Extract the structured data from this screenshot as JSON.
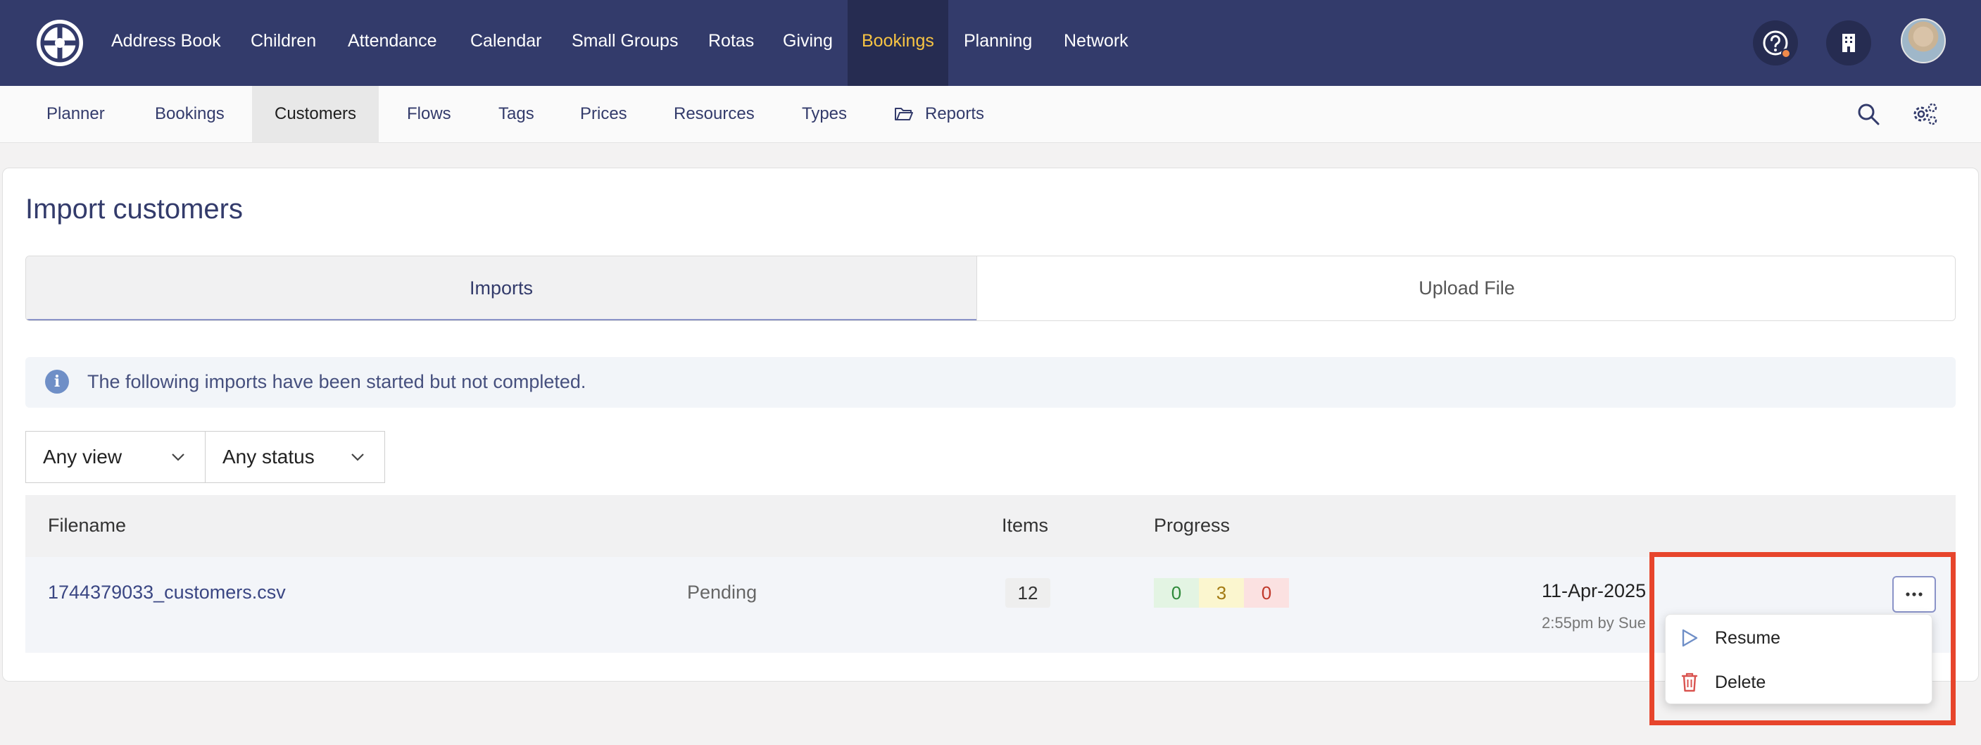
{
  "topnav": {
    "items": [
      "Address Book",
      "Children",
      "Attendance",
      "Calendar",
      "Small Groups",
      "Rotas",
      "Giving",
      "Bookings",
      "Planning",
      "Network"
    ],
    "active": "Bookings",
    "icons": [
      "help-icon",
      "building-icon",
      "avatar"
    ]
  },
  "subnav": {
    "items": [
      "Planner",
      "Bookings",
      "Customers",
      "Flows",
      "Tags",
      "Prices",
      "Resources",
      "Types",
      "Reports"
    ],
    "active": "Customers",
    "icons": [
      "folder-icon",
      "search-icon",
      "settings-icon"
    ]
  },
  "page": {
    "title": "Import customers",
    "tabs": [
      "Imports",
      "Upload File"
    ],
    "info": "The following imports have been started but not completed."
  },
  "filters": {
    "view": "Any view",
    "status": "Any status"
  },
  "table": {
    "headers": {
      "filename": "Filename",
      "items": "Items",
      "progress": "Progress"
    },
    "rows": [
      {
        "filename": "1744379033_customers.csv",
        "status": "Pending",
        "items": "12",
        "progress": [
          "0",
          "3",
          "0"
        ],
        "date": "11-Apr-2025",
        "byline": "2:55pm by Sue"
      }
    ]
  },
  "menu": {
    "items": [
      "Resume",
      "Delete"
    ]
  },
  "colors": {
    "nav_bg": "#333b6b",
    "nav_active_text": "#f7c443",
    "highlight": "#e7452c",
    "progress_green_bg": "#e3f4e3",
    "progress_yellow_bg": "#fbf6cf",
    "progress_red_bg": "#fbe1e1"
  }
}
